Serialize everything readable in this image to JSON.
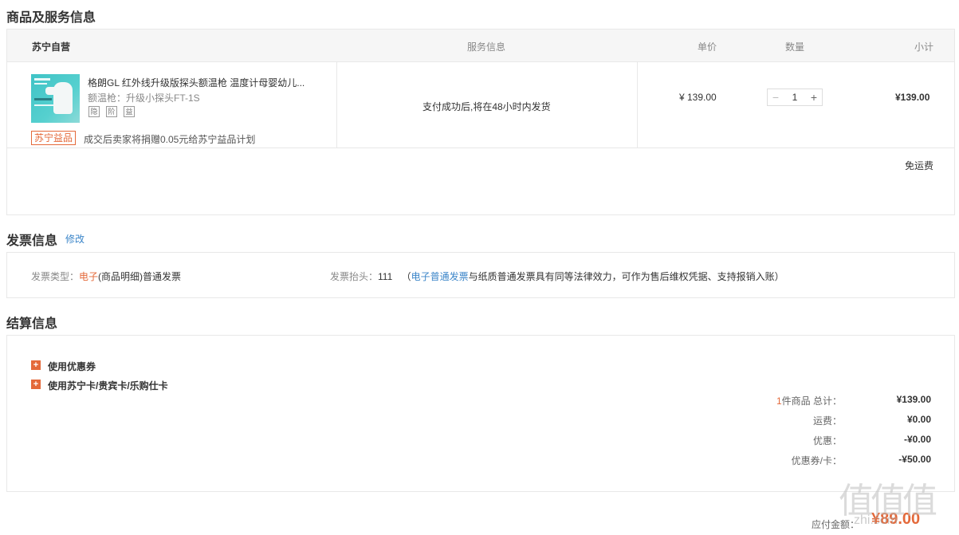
{
  "goods_section": {
    "title": "商品及服务信息",
    "store_name": "苏宁自营",
    "headers": {
      "service": "服务信息",
      "price": "单价",
      "quantity": "数量",
      "subtotal": "小计"
    },
    "item": {
      "name": "格朗GL 红外线升级版探头额温枪 温度计母婴幼儿...",
      "spec": "额温枪：升级小探头FT-1S",
      "service_icons": [
        "隐",
        "阶",
        "益"
      ],
      "charity_tag": "苏宁益品",
      "charity_text": "成交后卖家将捐赠0.05元给苏宁益品计划",
      "service_info": "支付成功后,将在48小时内发货",
      "price": "¥ 139.00",
      "quantity": "1",
      "minus": "−",
      "plus": "+",
      "subtotal": "¥139.00"
    },
    "shipping_note": "免运费"
  },
  "invoice_section": {
    "title": "发票信息",
    "edit_link": "修改",
    "type_label": "发票类型：",
    "type_value_highlight": "电子",
    "type_value_rest": "(商品明细)普通发票",
    "header_label": "发票抬头：",
    "header_value": "111",
    "note_open": "（",
    "note_link": "电子普通发票",
    "note_rest": "与纸质普通发票具有同等法律效力，可作为售后维权凭据、支持报销入账",
    "note_close": "）"
  },
  "settle_section": {
    "title": "结算信息",
    "options": [
      {
        "icon": "+",
        "label": "使用优惠券"
      },
      {
        "icon": "+",
        "label": "使用苏宁卡/贵宾卡/乐购仕卡"
      }
    ],
    "summary": {
      "count": "1",
      "total_label": "件商品 总计：",
      "total_value": "¥139.00",
      "freight_label": "运费：",
      "freight_value": "¥0.00",
      "discount_label": "优惠：",
      "discount_value": "-¥0.00",
      "coupon_label": "优惠券/卡：",
      "coupon_value": "-¥50.00"
    }
  },
  "footer": {
    "due_label": "应付金额：",
    "due_value": "¥89.00"
  },
  "watermark": {
    "text": "值值值",
    "url": "zhi.com"
  },
  "colors": {
    "accent": "#e4693a",
    "link": "#3c86c9",
    "border": "#e8e8e8",
    "header_bg": "#f6f6f6"
  }
}
